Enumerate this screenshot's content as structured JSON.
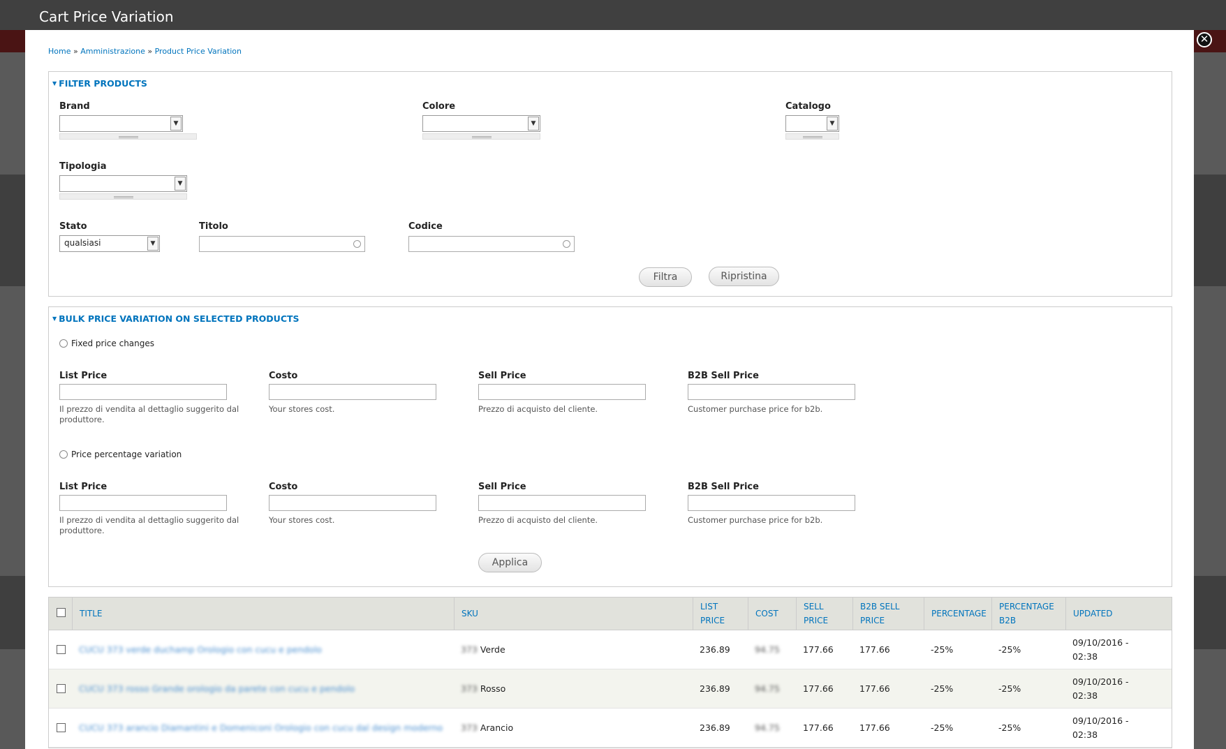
{
  "window": {
    "title": "Cart Price Variation",
    "close_symbol": "✕"
  },
  "breadcrumb": {
    "home": "Home",
    "sep": "»",
    "admin": "Amministrazione",
    "current": "Product Price Variation"
  },
  "filter": {
    "legend": "FILTER PRODUCTS",
    "brand_label": "Brand",
    "colore_label": "Colore",
    "catalogo_label": "Catalogo",
    "tipologia_label": "Tipologia",
    "stato_label": "Stato",
    "stato_value": "qualsiasi",
    "titolo_label": "Titolo",
    "codice_label": "Codice",
    "filtra_button": "Filtra",
    "ripristina_button": "Ripristina"
  },
  "bulk": {
    "legend": "BULK PRICE VARIATION ON SELECTED PRODUCTS",
    "fixed_radio": "Fixed price changes",
    "percent_radio": "Price percentage variation",
    "list_price_label": "List Price",
    "costo_label": "Costo",
    "sell_price_label": "Sell Price",
    "b2b_label": "B2B Sell Price",
    "list_price_desc": "Il prezzo di vendita al dettaglio suggerito dal produttore.",
    "costo_desc": "Your stores cost.",
    "sell_price_desc": "Prezzo di acquisto del cliente.",
    "b2b_desc": "Customer purchase price for b2b.",
    "applica_button": "Applica"
  },
  "table": {
    "headers": {
      "title": "TITLE",
      "sku": "SKU",
      "list_price_1": "LIST",
      "list_price_2": "PRICE",
      "cost": "COST",
      "sell_price_1": "SELL",
      "sell_price_2": "PRICE",
      "b2b_1": "B2B SELL",
      "b2b_2": "PRICE",
      "percentage": "PERCENTAGE",
      "perc_b2b_1": "PERCENTAGE",
      "perc_b2b_2": "B2B",
      "updated": "UPDATED"
    },
    "rows": [
      {
        "title": "CUCU 373 verde duchamp Orologio con cucu e pendolo",
        "sku_code": "373",
        "sku_color": "Verde",
        "list_price": "236.89",
        "cost": "94.75",
        "sell_price": "177.66",
        "b2b": "177.66",
        "percentage": "-25%",
        "perc_b2b": "-25%",
        "updated_1": "09/10/2016 -",
        "updated_2": "02:38"
      },
      {
        "title": "CUCU 373 rosso Grande orologio da parete con cucu e pendolo",
        "sku_code": "373",
        "sku_color": "Rosso",
        "list_price": "236.89",
        "cost": "94.75",
        "sell_price": "177.66",
        "b2b": "177.66",
        "percentage": "-25%",
        "perc_b2b": "-25%",
        "updated_1": "09/10/2016 -",
        "updated_2": "02:38"
      },
      {
        "title": "CUCU 373 arancio Diamantini e Domeniconi Orologio con cucu dal design moderno",
        "sku_code": "373",
        "sku_color": "Arancio",
        "list_price": "236.89",
        "cost": "94.75",
        "sell_price": "177.66",
        "b2b": "177.66",
        "percentage": "-25%",
        "perc_b2b": "-25%",
        "updated_1": "09/10/2016 -",
        "updated_2": "02:38"
      }
    ]
  },
  "colors": {
    "link": "#0074bd",
    "titlebar": "#404040",
    "header_bg": "#e1e2dc"
  }
}
